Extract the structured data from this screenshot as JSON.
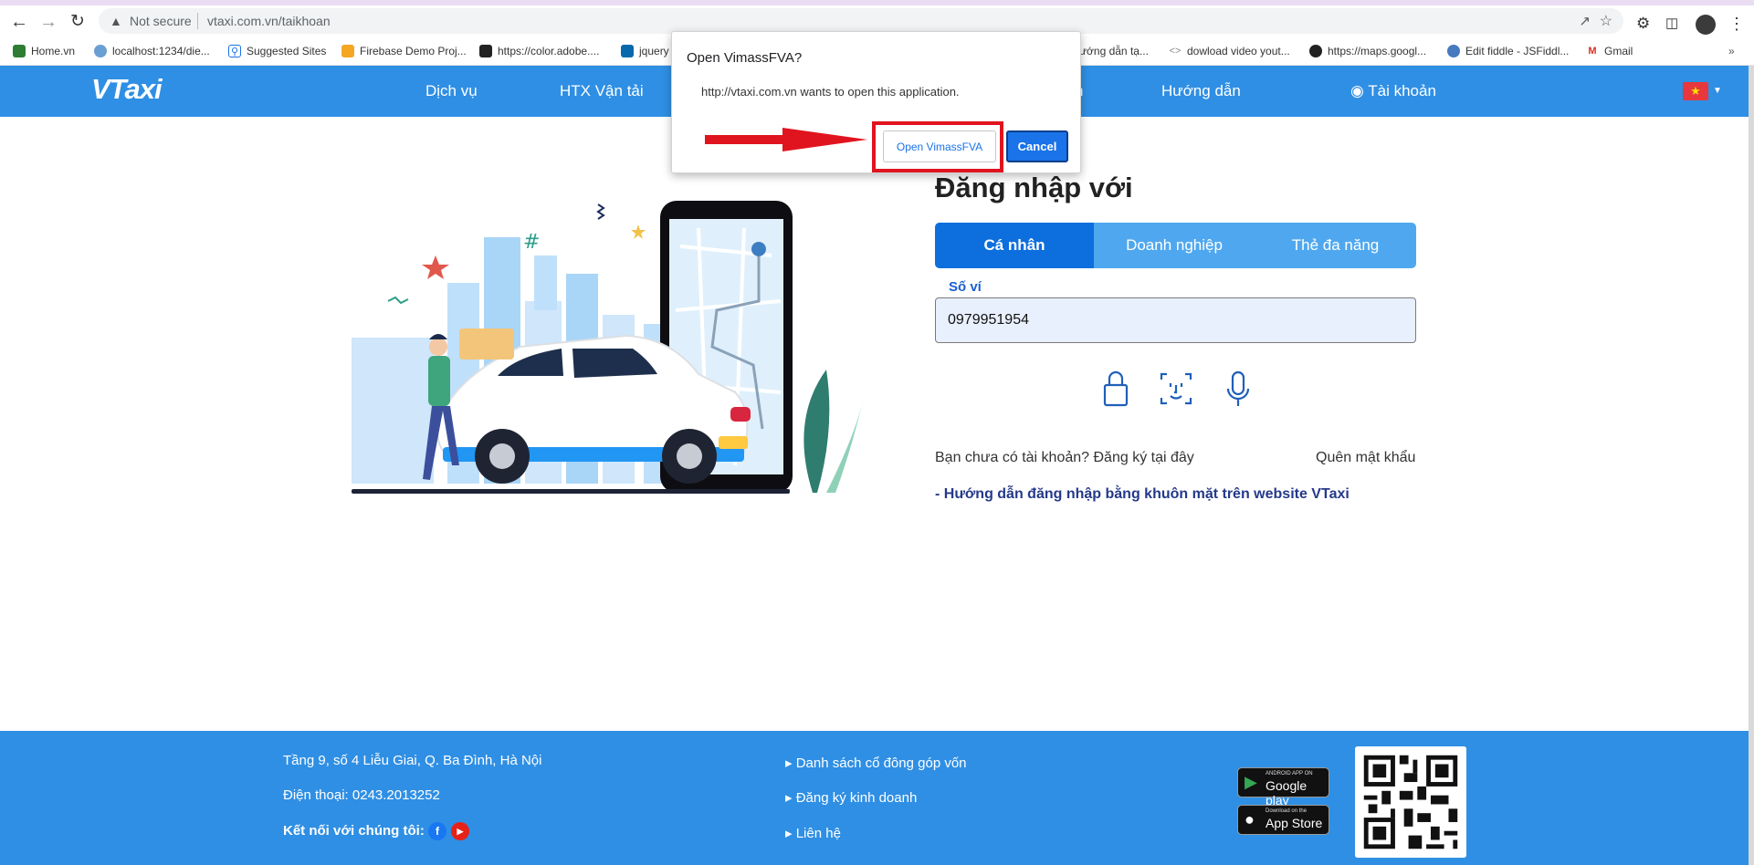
{
  "browser": {
    "security_label": "Not secure",
    "url": "vtaxi.com.vn/taikhoan",
    "bookmarks": [
      {
        "label": "Home.vn",
        "color": "#2e7d32",
        "icon": "home-bookmark-icon"
      },
      {
        "label": "localhost:1234/die...",
        "color": "#6a9fd4",
        "icon": "globe-bookmark-icon"
      },
      {
        "label": "Suggested Sites",
        "color": "#1a73e8",
        "icon": "search-bookmark-icon"
      },
      {
        "label": "Firebase Demo Proj...",
        "color": "#f5a623",
        "icon": "firebase-bookmark-icon"
      },
      {
        "label": "https://color.adobe....",
        "color": "#222222",
        "icon": "adobe-bookmark-icon"
      },
      {
        "label": "jquery",
        "color": "#0769ad",
        "icon": "jquery-bookmark-icon"
      },
      {
        "label": "ướng dẫn tạ...",
        "color": "#ffffff",
        "icon": "page-bookmark-icon"
      },
      {
        "label": "dowload video yout...",
        "color": "#888888",
        "icon": "code-bookmark-icon"
      },
      {
        "label": "https://maps.googl...",
        "color": "#222222",
        "icon": "globe-bookmark-icon"
      },
      {
        "label": "Edit fiddle - JSFiddl...",
        "color": "#4679bd",
        "icon": "cloud-bookmark-icon"
      },
      {
        "label": "Gmail",
        "color": "#d93025",
        "icon": "gmail-bookmark-icon"
      }
    ]
  },
  "header": {
    "logo": "VTaxi",
    "nav": [
      "Dịch vụ",
      "HTX Vận tải",
      "n",
      "Hướng dẫn",
      "Tài khoản"
    ],
    "account_icon": "user-circle-icon",
    "flag_icon": "vietnam-flag-icon"
  },
  "dialog": {
    "title": "Open VimassFVA?",
    "message": "http://vtaxi.com.vn wants to open this application.",
    "open_label": "Open VimassFVA",
    "cancel_label": "Cancel"
  },
  "login": {
    "title": "Đăng nhập với",
    "tabs": [
      "Cá nhân",
      "Doanh nghiệp",
      "Thẻ đa năng"
    ],
    "active_tab": 0,
    "wallet_label": "Số ví",
    "wallet_value": "0979951954",
    "auth_icons": [
      "lock-icon",
      "face-id-icon",
      "microphone-icon"
    ],
    "signup_text": "Bạn chưa có tài khoản? Đăng ký tại đây",
    "forgot_text": "Quên mật khẩu",
    "guide_link": "- Hướng dẫn đăng nhập bằng khuôn mặt trên website VTaxi"
  },
  "footer": {
    "address": "Tầng 9, số 4 Liễu Giai, Q. Ba Đình, Hà Nội",
    "phone": "Điện thoại: 0243.2013252",
    "connect": "Kết nối với chúng tôi:",
    "links": [
      "Danh sách cổ đông góp vốn",
      "Đăng ký kinh doanh",
      "Liên hệ"
    ],
    "google_play_small": "ANDROID APP ON",
    "google_play": "Google play",
    "app_store_small": "Download on the",
    "app_store": "App Store"
  },
  "colors": {
    "brand_blue": "#2f8fe4",
    "active_tab": "#0d6fde",
    "highlight_red": "#e0141f"
  }
}
